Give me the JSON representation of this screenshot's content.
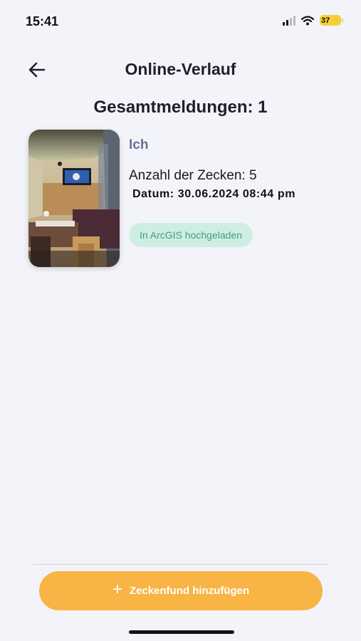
{
  "status_bar": {
    "time": "15:41",
    "battery": "37",
    "icons": [
      "signal-icon",
      "wifi-icon",
      "battery-charging-icon"
    ]
  },
  "header": {
    "back_icon": "arrow-left-icon",
    "title": "Online-Verlauf"
  },
  "summary": {
    "total_label": "Gesamtmeldungen: 1"
  },
  "reports": [
    {
      "user": "Ich",
      "count_label": "Anzahl der Zecken: 5",
      "date_label": "Datum: 30.06.2024 08:44 pm",
      "status": "In ArcGIS hochgeladen",
      "photo": "room-photo"
    }
  ],
  "footer": {
    "add_icon": "plus-icon",
    "add_button_label": "Zeckenfund hinzufügen"
  },
  "colors": {
    "background": "#f3f4f9",
    "accent": "#f8b444",
    "badge_bg": "#cfeee3",
    "badge_text": "#3f9f7c",
    "user_text": "#6c6f9a"
  }
}
